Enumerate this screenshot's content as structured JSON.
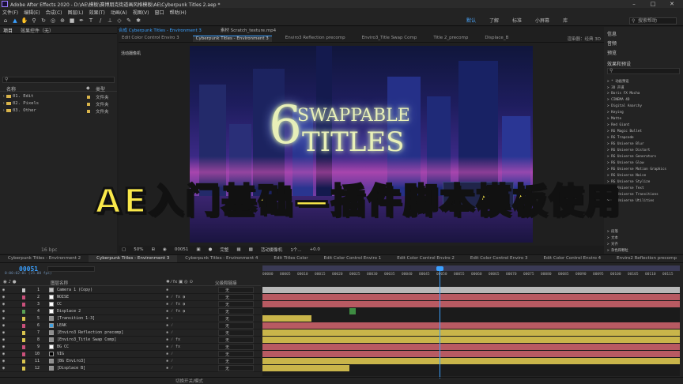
{
  "titlebar": {
    "title": "Adobe After Effects 2020 - D:\\AE\\模板\\赛博朋克街道画风格模板\\AE\\Cyberpunk Titles 2.aep *",
    "minimize": "–",
    "maximize": "□",
    "close": "✕"
  },
  "menu": [
    "文件(F)",
    "编辑(E)",
    "合成(C)",
    "图层(L)",
    "效果(T)",
    "动画(A)",
    "视图(V)",
    "窗口",
    "帮助(H)"
  ],
  "toolbar": {
    "workspaces": [
      "默认",
      "了解",
      "标准",
      "小屏幕",
      "库"
    ],
    "search_placeholder": "搜索帮助"
  },
  "project": {
    "tabs": [
      "项目",
      "效果控件（无）"
    ],
    "columns": {
      "name": "名称",
      "type": "类型"
    },
    "items": [
      {
        "name": "01. Edit",
        "type": "文件夹"
      },
      {
        "name": "02. Pixels",
        "type": "文件夹"
      },
      {
        "name": "03. Other",
        "type": "文件夹"
      }
    ],
    "bpc": "16 bpc"
  },
  "viewer": {
    "panel_tabs": [
      "合成 Cyberpunk Titles - Environment 3",
      "素材 Scratch_texture.mp4"
    ],
    "comp_tabs": [
      "Edit Color Control Enviro 3",
      "Cyberpunk Titles - Environment 3",
      "Enviro3 Reflection precomp",
      "Enviro3_Title Swap Comp",
      "Title 2_precomp",
      "Displace_B"
    ],
    "renderer_label": "渲染器：",
    "renderer": "经典 3D",
    "camera_label": "活动摄像机",
    "preview_digit": "6",
    "preview_line1": "SWAPPABLE",
    "preview_line2": "TITLES",
    "controls": [
      "50%",
      "完整",
      "活动摄像机",
      "1个...",
      "+0.0"
    ],
    "current_frame": "00051"
  },
  "right_panel": {
    "heads": [
      "信息",
      "音频",
      "预览"
    ],
    "effects_title": "效果和预设",
    "effects": [
      "> * 动画预设",
      "> 3D 声道",
      "> Boris FX Mocha",
      "> CINEMA 4D",
      "> Digital Anarchy",
      "> Keying",
      "> Matte",
      "> Red Giant",
      "> RG Magic Bullet",
      "> RG Trapcode",
      "> RG Universe Blur",
      "> RG Universe Distort",
      "> RG Universe Generators",
      "> RG Universe Glow",
      "> RG Universe Motion Graphics",
      "> RG Universe Noise",
      "> RG Universe Stylize",
      "> RG Universe Text",
      "> RG Universe Transitions",
      "> RG Universe Utilities"
    ],
    "bottom": [
      "> 段落",
      "> 文本",
      "> 对齐",
      "> 杂色和颗粒"
    ]
  },
  "overlay_title": "AE入门基础—插件脚本模板使用",
  "timeline": {
    "tabs": [
      "Cyberpunk Titles - Environment 2",
      "Cyberpunk Titles - Environment 3",
      "Cyberpunk Titles - Environment 4",
      "Edit Titles Color",
      "Edit Color Control Enviro 1",
      "Edit Color Control Enviro 2",
      "Edit Color Control Enviro 3",
      "Edit Color Control Enviro 4",
      "Enviro2 Reflection precomp"
    ],
    "timecode": "00051",
    "timecode_sub": "0:00:02:01 (25.00 fps)",
    "col_layer": "图层名称",
    "col_parent": "父级和链接",
    "parent_none": "无",
    "footer": "切换开关/模式",
    "ruler": [
      "00000",
      "00005",
      "00010",
      "00015",
      "00020",
      "00025",
      "00030",
      "00035",
      "00040",
      "00045",
      "00050",
      "00055",
      "00060",
      "00065",
      "00070",
      "00075",
      "00080",
      "00085",
      "00090",
      "00095",
      "00100",
      "00105",
      "00110",
      "00115",
      "00120"
    ],
    "layers": [
      {
        "num": "1",
        "name": "Camera 1 (Copy)",
        "color": "#c6c6c6"
      },
      {
        "num": "2",
        "name": "NOISE",
        "color": "#ffffff"
      },
      {
        "num": "3",
        "name": "CC",
        "color": "#ffffff"
      },
      {
        "num": "4",
        "name": "Displace 2",
        "color": "#ffffff"
      },
      {
        "num": "5",
        "name": "[Transition 1-3]",
        "color": "#8f8f8f"
      },
      {
        "num": "6",
        "name": "LEAK",
        "color": "#3fa0e0"
      },
      {
        "num": "7",
        "name": "[Enviro3 Reflection precomp]",
        "color": "#8f8f8f"
      },
      {
        "num": "8",
        "name": "[Enviro3_Title Swap Comp]",
        "color": "#8f8f8f"
      },
      {
        "num": "9",
        "name": "BG CC",
        "color": "#ffffff"
      },
      {
        "num": "10",
        "name": "VIG",
        "color": "#000000"
      },
      {
        "num": "11",
        "name": "[BG Enviro3]",
        "color": "#8f8f8f"
      },
      {
        "num": "12",
        "name": "[Displace B]",
        "color": "#8f8f8f"
      }
    ]
  }
}
